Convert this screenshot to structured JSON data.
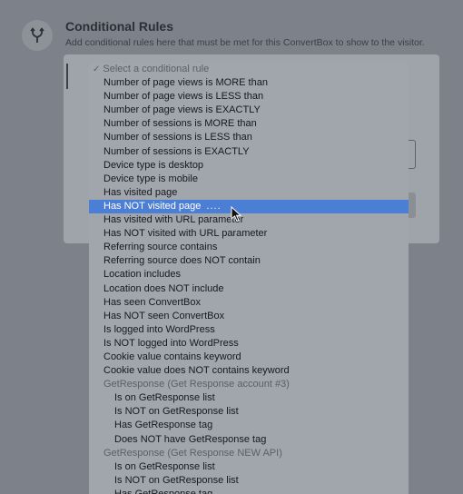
{
  "header": {
    "title": "Conditional Rules",
    "description": "Add conditional rules here that must be met for this ConvertBox to show to the visitor.",
    "icon": "branch-icon"
  },
  "dropdown": {
    "placeholder": "Select a conditional rule",
    "options": [
      "Number of page views is MORE than",
      "Number of page views is LESS than",
      "Number of page views is EXACTLY",
      "Number of sessions is MORE than",
      "Number of sessions is LESS than",
      "Number of sessions is EXACTLY",
      "Device type is desktop",
      "Device type is mobile",
      "Has visited page",
      "Has NOT visited page",
      "Has visited with URL parameter",
      "Has NOT visited with URL parameter",
      "Referring source contains",
      "Referring source does NOT contain",
      "Location includes",
      "Location does NOT include",
      "Has seen ConvertBox",
      "Has NOT seen ConvertBox",
      "Is logged into WordPress",
      "Is NOT logged into WordPress",
      "Cookie value contains keyword",
      "Cookie value does NOT contains keyword"
    ],
    "selected_index": 9,
    "selected_suffix": "....",
    "groups": [
      {
        "label": "GetResponse (Get Response account #3)",
        "options": [
          "Is on GetResponse list",
          "Is NOT on GetResponse list",
          "Has GetResponse tag",
          "Does NOT have GetResponse tag"
        ]
      },
      {
        "label": "GetResponse (Get Response NEW API)",
        "options": [
          "Is on GetResponse list",
          "Is NOT on GetResponse list",
          "Has GetResponse tag"
        ]
      }
    ]
  },
  "colors": {
    "highlight": "#4b7fd6",
    "backdrop": "#7d828a",
    "menu_bg": "#a1a5ac"
  }
}
